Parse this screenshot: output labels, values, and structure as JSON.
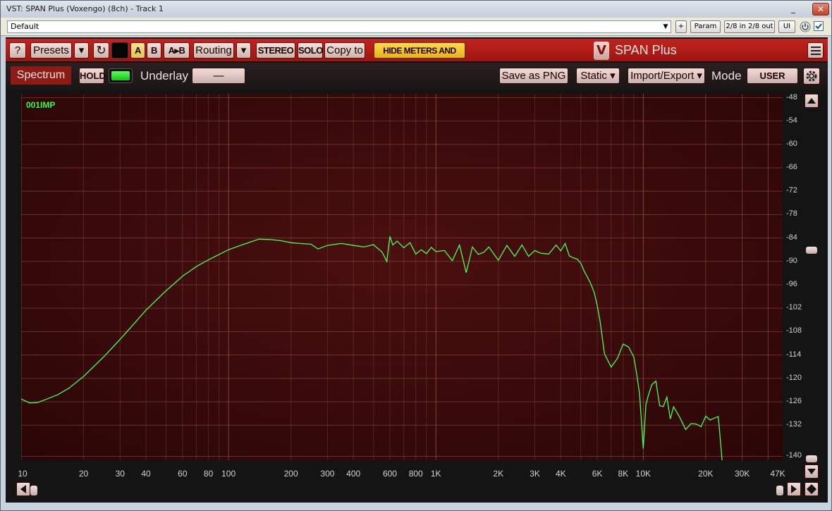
{
  "window": {
    "title": "VST: SPAN Plus (Voxengo) (8ch) - Track 1",
    "minimize_glyph": "_",
    "close_glyph": "✕"
  },
  "host": {
    "preset": "Default",
    "add_label": "+",
    "param_label": "Param",
    "io_label": "2/8 in 2/8 out",
    "ui_label": "UI"
  },
  "toolbar": {
    "help": "?",
    "presets": "Presets",
    "presets_arrow": "▾",
    "reset_glyph": "↻",
    "a": "A",
    "b": "B",
    "ab": "A▸B",
    "routing": "Routing",
    "routing_arrow": "▾",
    "stereo": "STEREO",
    "solo": "SOLO",
    "copy_to": "Copy to",
    "hide_meters": "HIDE METERS AND STATS",
    "logo_mark": "V",
    "logo_text": "SPAN Plus"
  },
  "subbar": {
    "spectrum_tab": "Spectrum",
    "hold": "HOLD",
    "underlay_label": "Underlay",
    "underlay_value": "—",
    "save_png": "Save as PNG",
    "static": "Static ▾",
    "import_export": "Import/Export ▾",
    "mode_label": "Mode",
    "mode_value": "USER"
  },
  "trace_name": "001IMP",
  "colors": {
    "trace": "#4cff4c",
    "plot_bg": "#3a0a0a",
    "accent": "#b81e18",
    "hide_btn": "#f5c92e"
  },
  "chart_data": {
    "type": "line",
    "x_scale": "log",
    "xlim": [
      10,
      47000
    ],
    "ylim": [
      -141,
      -47
    ],
    "grid": true,
    "x_ticks": [
      "10",
      "20",
      "30",
      "40",
      "60",
      "80",
      "100",
      "200",
      "300",
      "400",
      "600",
      "800",
      "1K",
      "2K",
      "3K",
      "4K",
      "6K",
      "8K",
      "10K",
      "20K",
      "30K",
      "47K"
    ],
    "x_tick_values": [
      10,
      20,
      30,
      40,
      60,
      80,
      100,
      200,
      300,
      400,
      600,
      800,
      1000,
      2000,
      3000,
      4000,
      6000,
      8000,
      10000,
      20000,
      30000,
      47000
    ],
    "y_ticks": [
      -48,
      -54,
      -60,
      -66,
      -72,
      -78,
      -84,
      -90,
      -96,
      -102,
      -108,
      -114,
      -120,
      -126,
      -132,
      -140
    ],
    "series": [
      {
        "x": [
          10,
          11,
          12,
          13,
          15,
          17,
          20,
          25,
          30,
          35,
          40,
          50,
          60,
          70,
          80,
          100,
          120,
          140,
          160,
          180,
          200,
          220,
          250,
          270,
          300,
          350,
          400,
          450,
          500,
          550,
          580,
          600,
          620,
          650,
          700,
          750,
          800,
          850,
          900,
          950,
          1000,
          1100,
          1200,
          1300,
          1400,
          1500,
          1600,
          1700,
          1800,
          2000,
          2200,
          2400,
          2600,
          2800,
          3000,
          3200,
          3500,
          3800,
          4000,
          4200,
          4400,
          4600,
          4800,
          5000,
          5200,
          5400,
          5600,
          5800,
          6000,
          6200,
          6500,
          7000,
          7500,
          8000,
          8500,
          9000,
          9300,
          9600,
          10000,
          10300,
          10600,
          11000,
          11500,
          12000,
          12500,
          13000,
          13500,
          14000,
          15000,
          16000,
          17000,
          18000,
          19000,
          20000,
          21000,
          22000,
          23000,
          24000
        ],
        "y": [
          -125.3,
          -126.3,
          -126.2,
          -125.5,
          -124.2,
          -122.5,
          -119.5,
          -114.5,
          -110,
          -106,
          -102.5,
          -97.5,
          -93.8,
          -91.3,
          -89.6,
          -87,
          -85.5,
          -84.3,
          -84.4,
          -84.7,
          -85.2,
          -85.4,
          -85.6,
          -86.8,
          -85.9,
          -85.4,
          -85.9,
          -86.3,
          -85.7,
          -87.6,
          -90,
          -83.6,
          -85.8,
          -84.8,
          -86.5,
          -85.2,
          -88.1,
          -87,
          -88,
          -86.4,
          -87.5,
          -87.2,
          -89.8,
          -85.8,
          -92.9,
          -86.3,
          -88.2,
          -87.7,
          -86.3,
          -89.7,
          -85.9,
          -88.7,
          -85.8,
          -88.7,
          -87.2,
          -87.9,
          -88.1,
          -85.8,
          -87.3,
          -85.4,
          -88.6,
          -89.1,
          -89.4,
          -90.5,
          -92.6,
          -94.2,
          -95.9,
          -98,
          -101.4,
          -105.6,
          -113.7,
          -117.1,
          -114.9,
          -111.2,
          -112,
          -114.5,
          -119,
          -124,
          -138,
          -126.7,
          -124.2,
          -121.6,
          -120.7,
          -127,
          -127.2,
          -124.8,
          -130.4,
          -127.3,
          -130,
          -133.1,
          -131.6,
          -131.7,
          -132.4,
          -129.7,
          -130.7,
          -130.2,
          -129.8,
          -141.1
        ]
      }
    ]
  }
}
